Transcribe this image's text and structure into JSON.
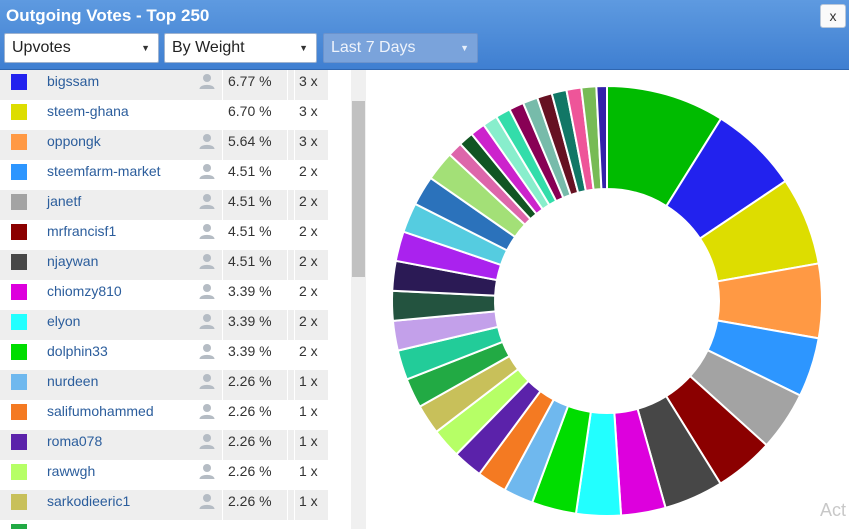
{
  "window": {
    "title": "Outgoing Votes - Top 250",
    "close_label": "x"
  },
  "filters": {
    "type": {
      "selected": "Upvotes"
    },
    "sort": {
      "selected": "By Weight"
    },
    "period": {
      "selected": "Last 7 Days"
    }
  },
  "votes": [
    {
      "name": "bigssam",
      "percent": "6.77 %",
      "count": "3 x",
      "color": "#2222ee",
      "icon": "user-icon"
    },
    {
      "name": "steem-ghana",
      "percent": "6.70 %",
      "count": "3 x",
      "color": "#dddd00",
      "icon": ""
    },
    {
      "name": "oppongk",
      "percent": "5.64 %",
      "count": "3 x",
      "color": "#ff9944",
      "icon": "user-icon"
    },
    {
      "name": "steemfarm-market",
      "percent": "4.51 %",
      "count": "2 x",
      "color": "#2d96ff",
      "icon": "user-icon"
    },
    {
      "name": "janetf",
      "percent": "4.51 %",
      "count": "2 x",
      "color": "#a3a3a3",
      "icon": "user-icon"
    },
    {
      "name": "mrfrancisf1",
      "percent": "4.51 %",
      "count": "2 x",
      "color": "#8b0000",
      "icon": "user-icon"
    },
    {
      "name": "njaywan",
      "percent": "4.51 %",
      "count": "2 x",
      "color": "#474747",
      "icon": "user-icon"
    },
    {
      "name": "chiomzy810",
      "percent": "3.39 %",
      "count": "2 x",
      "color": "#dd00dd",
      "icon": "user-icon"
    },
    {
      "name": "elyon",
      "percent": "3.39 %",
      "count": "2 x",
      "color": "#22ffff",
      "icon": "user-icon"
    },
    {
      "name": "dolphin33",
      "percent": "3.39 %",
      "count": "2 x",
      "color": "#00dd00",
      "icon": "user-icon"
    },
    {
      "name": "nurdeen",
      "percent": "2.26 %",
      "count": "1 x",
      "color": "#6fb8ee",
      "icon": "user-icon"
    },
    {
      "name": "salifumohammed",
      "percent": "2.26 %",
      "count": "1 x",
      "color": "#f47a22",
      "icon": "user-icon"
    },
    {
      "name": "roma078",
      "percent": "2.26 %",
      "count": "1 x",
      "color": "#5b22aa",
      "icon": "user-icon"
    },
    {
      "name": "rawwgh",
      "percent": "2.26 %",
      "count": "1 x",
      "color": "#b6ff66",
      "icon": "user-icon"
    },
    {
      "name": "sarkodieeric1",
      "percent": "2.26 %",
      "count": "1 x",
      "color": "#c8c05a",
      "icon": "user-icon"
    },
    {
      "name": "",
      "percent": "",
      "count": "",
      "color": "#22aa44",
      "icon": ""
    }
  ],
  "chart_data": {
    "type": "pie",
    "donut": true,
    "slices": [
      {
        "value": 9.0,
        "color": "#00bb00"
      },
      {
        "value": 6.77,
        "color": "#2222ee"
      },
      {
        "value": 6.7,
        "color": "#dddd00"
      },
      {
        "value": 5.64,
        "color": "#ff9944"
      },
      {
        "value": 4.51,
        "color": "#2d96ff"
      },
      {
        "value": 4.51,
        "color": "#a3a3a3"
      },
      {
        "value": 4.51,
        "color": "#8b0000"
      },
      {
        "value": 4.51,
        "color": "#474747"
      },
      {
        "value": 3.39,
        "color": "#dd00dd"
      },
      {
        "value": 3.39,
        "color": "#22ffff"
      },
      {
        "value": 3.39,
        "color": "#00dd00"
      },
      {
        "value": 2.26,
        "color": "#6fb8ee"
      },
      {
        "value": 2.26,
        "color": "#f47a22"
      },
      {
        "value": 2.26,
        "color": "#5b22aa"
      },
      {
        "value": 2.26,
        "color": "#b6ff66"
      },
      {
        "value": 2.26,
        "color": "#c8c05a"
      },
      {
        "value": 2.26,
        "color": "#22aa44"
      },
      {
        "value": 2.26,
        "color": "#22cc99"
      },
      {
        "value": 2.26,
        "color": "#c3a0ea"
      },
      {
        "value": 2.26,
        "color": "#23533f"
      },
      {
        "value": 2.26,
        "color": "#2b1a55"
      },
      {
        "value": 2.26,
        "color": "#aa22ee"
      },
      {
        "value": 2.26,
        "color": "#55cce0"
      },
      {
        "value": 2.26,
        "color": "#2b72bb"
      },
      {
        "value": 2.26,
        "color": "#a3e077"
      },
      {
        "value": 1.13,
        "color": "#dd66aa"
      },
      {
        "value": 1.13,
        "color": "#115522"
      },
      {
        "value": 1.13,
        "color": "#cc22cc"
      },
      {
        "value": 1.13,
        "color": "#88eecc"
      },
      {
        "value": 1.13,
        "color": "#33ddaa"
      },
      {
        "value": 1.13,
        "color": "#880055"
      },
      {
        "value": 1.13,
        "color": "#77bbaa"
      },
      {
        "value": 1.13,
        "color": "#661122"
      },
      {
        "value": 1.13,
        "color": "#117766"
      },
      {
        "value": 1.13,
        "color": "#ee5599"
      },
      {
        "value": 1.13,
        "color": "#77bb55"
      },
      {
        "value": 0.8,
        "color": "#3322aa"
      }
    ]
  },
  "watermark": "Act"
}
